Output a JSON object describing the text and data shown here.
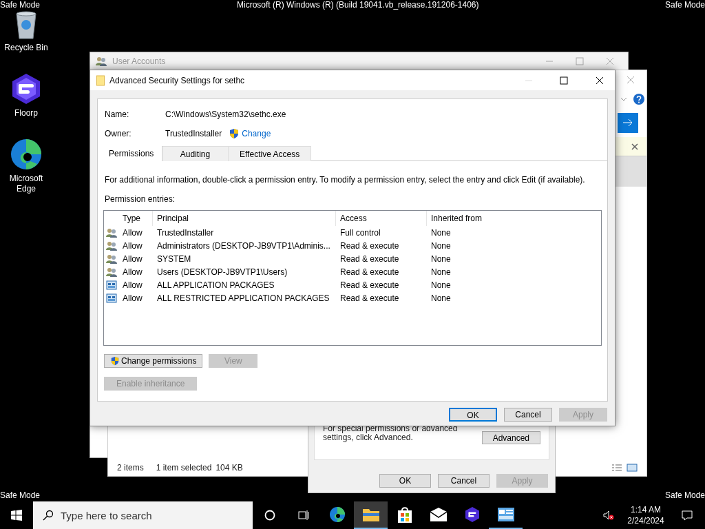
{
  "screen_overlay": {
    "top_left": "Safe Mode",
    "top_center": "Microsoft (R) Windows (R) (Build 19041.vb_release.191206-1406)",
    "top_right": "Safe Mode",
    "bottom_left": "Safe Mode",
    "bottom_right": "Safe Mode"
  },
  "desktop_icons": [
    {
      "label": "Recycle Bin",
      "kind": "recycle"
    },
    {
      "label": "Floorp",
      "kind": "floorp"
    },
    {
      "label": "Microsoft Edge",
      "kind": "edge"
    }
  ],
  "back_window": {
    "title": "User Accounts"
  },
  "explorer_window": {
    "status": {
      "count": "2 items",
      "selection": "1 item selected",
      "size": "104 KB"
    }
  },
  "properties_dialog": {
    "note": "For special permissions or advanced settings, click Advanced.",
    "advanced_button": "Advanced",
    "buttons": [
      {
        "label": "OK",
        "disabled": false
      },
      {
        "label": "Cancel",
        "disabled": false
      },
      {
        "label": "Apply",
        "disabled": true
      }
    ]
  },
  "dialog": {
    "title": "Advanced Security Settings for sethc",
    "name_label": "Name:",
    "name_value": "C:\\Windows\\System32\\sethc.exe",
    "owner_label": "Owner:",
    "owner_value": "TrustedInstaller",
    "owner_link": "Change",
    "tabs": [
      {
        "label": "Permissions",
        "selected": true
      },
      {
        "label": "Auditing",
        "selected": false
      },
      {
        "label": "Effective Access",
        "selected": false
      }
    ],
    "info": "For additional information, double-click a permission entry. To modify a permission entry, select the entry and click Edit (if available).",
    "entries_label": "Permission entries:",
    "columns": [
      "Type",
      "Principal",
      "Access",
      "Inherited from"
    ],
    "rows": [
      {
        "kind": "group",
        "type": "Allow",
        "principal": "TrustedInstaller",
        "access": "Full control",
        "inherited": "None"
      },
      {
        "kind": "group",
        "type": "Allow",
        "principal": "Administrators (DESKTOP-JB9VTP1\\Adminis...",
        "access": "Read & execute",
        "inherited": "None"
      },
      {
        "kind": "group",
        "type": "Allow",
        "principal": "SYSTEM",
        "access": "Read & execute",
        "inherited": "None"
      },
      {
        "kind": "group",
        "type": "Allow",
        "principal": "Users (DESKTOP-JB9VTP1\\Users)",
        "access": "Read & execute",
        "inherited": "None"
      },
      {
        "kind": "package",
        "type": "Allow",
        "principal": "ALL APPLICATION PACKAGES",
        "access": "Read & execute",
        "inherited": "None"
      },
      {
        "kind": "package",
        "type": "Allow",
        "principal": "ALL RESTRICTED APPLICATION PACKAGES",
        "access": "Read & execute",
        "inherited": "None"
      }
    ],
    "actions": [
      [
        {
          "label": "Change permissions",
          "disabled": false,
          "shield": true
        },
        {
          "label": "View",
          "disabled": true,
          "shield": false
        }
      ],
      [
        {
          "label": "Enable inheritance",
          "disabled": true,
          "shield": false
        }
      ]
    ],
    "buttons": [
      {
        "label": "OK",
        "disabled": false,
        "default": true
      },
      {
        "label": "Cancel",
        "disabled": false,
        "default": false
      },
      {
        "label": "Apply",
        "disabled": true,
        "default": false
      }
    ]
  },
  "taskbar": {
    "search_placeholder": "Type here to search",
    "apps": [
      {
        "kind": "edge",
        "selected": false,
        "running": false
      },
      {
        "kind": "explorer",
        "selected": true,
        "running": true
      },
      {
        "kind": "store",
        "selected": false,
        "running": false
      },
      {
        "kind": "mail",
        "selected": false,
        "running": false
      },
      {
        "kind": "floorp",
        "selected": false,
        "running": false
      },
      {
        "kind": "control-panel",
        "selected": false,
        "running": true
      }
    ],
    "time": "1:14 AM",
    "date": "2/24/2024"
  }
}
